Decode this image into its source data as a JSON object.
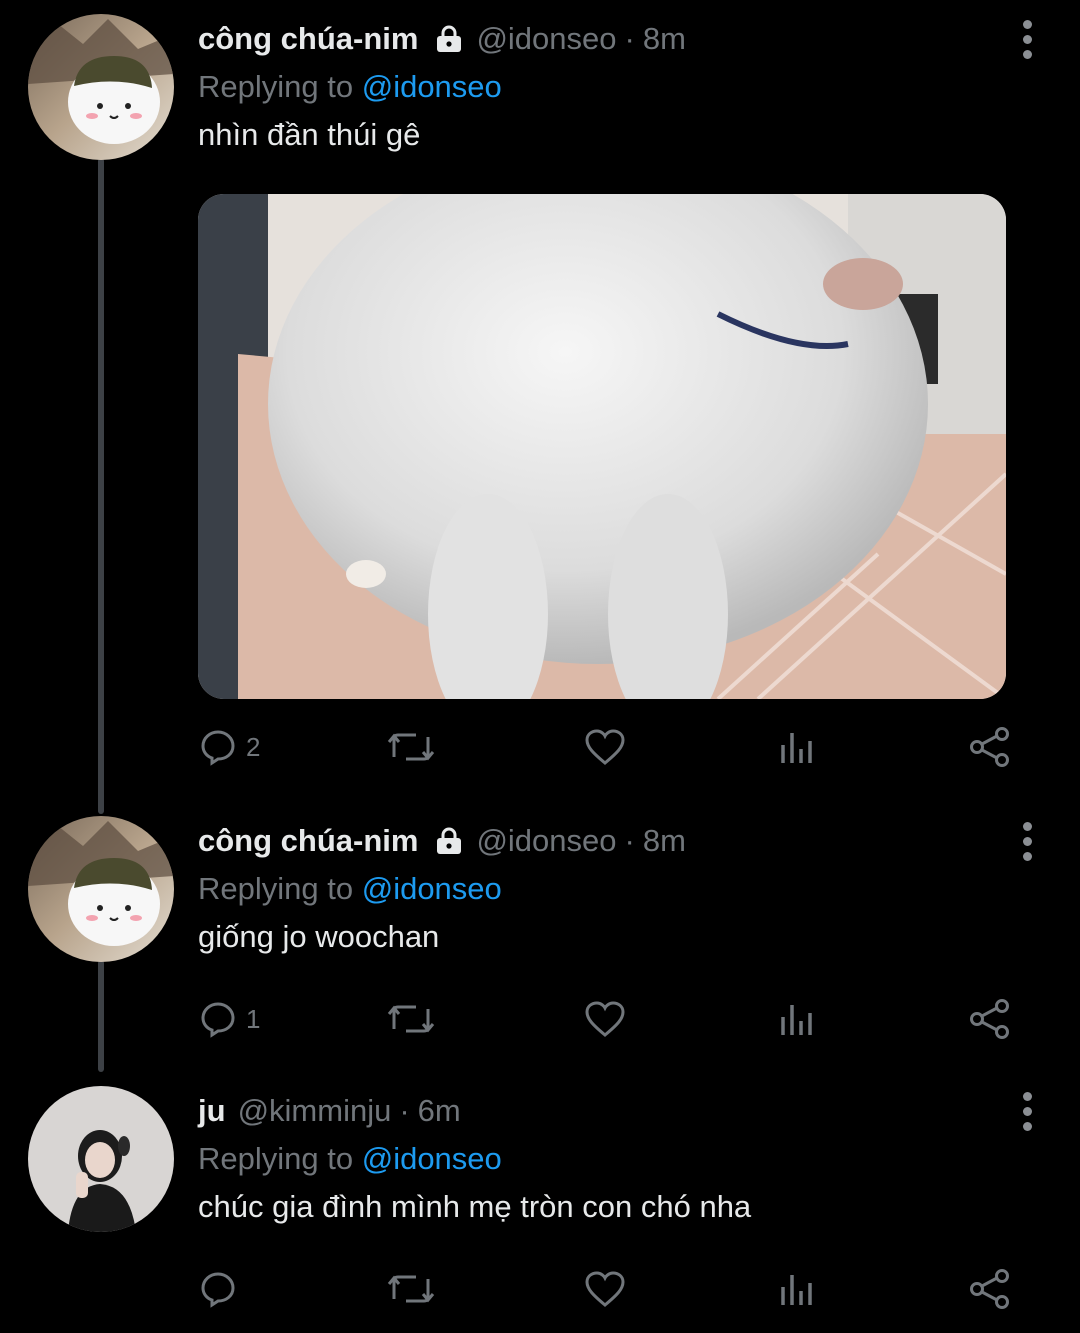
{
  "tweets": [
    {
      "name": "công chúa-nim",
      "handle": "@idonseo",
      "time": "8m",
      "replying_label": "Replying to",
      "replying_to": "@idonseo",
      "text": "nhìn đần thúi gê",
      "reply_count": "2",
      "has_media": true,
      "locked": true
    },
    {
      "name": "công chúa-nim",
      "handle": "@idonseo",
      "time": "8m",
      "replying_label": "Replying to",
      "replying_to": "@idonseo",
      "text": "giống jo woochan",
      "reply_count": "1",
      "locked": true
    },
    {
      "name": "ju",
      "handle": "@kimminju",
      "time": "6m",
      "replying_label": "Replying to",
      "replying_to": "@idonseo",
      "text": "chúc gia đình mình mẹ tròn con chó nha",
      "reply_count": "",
      "locked": false
    }
  ],
  "separator": "·",
  "icons": {
    "lock": "lock-icon",
    "more": "more-vertical-icon",
    "reply": "reply-icon",
    "retweet": "retweet-icon",
    "like": "heart-icon",
    "views": "analytics-icon",
    "share": "share-icon"
  },
  "colors": {
    "background": "#000000",
    "text": "#e7e9ea",
    "secondary": "#71767b",
    "link": "#1d9bf0",
    "thread_line": "#3d4146"
  }
}
